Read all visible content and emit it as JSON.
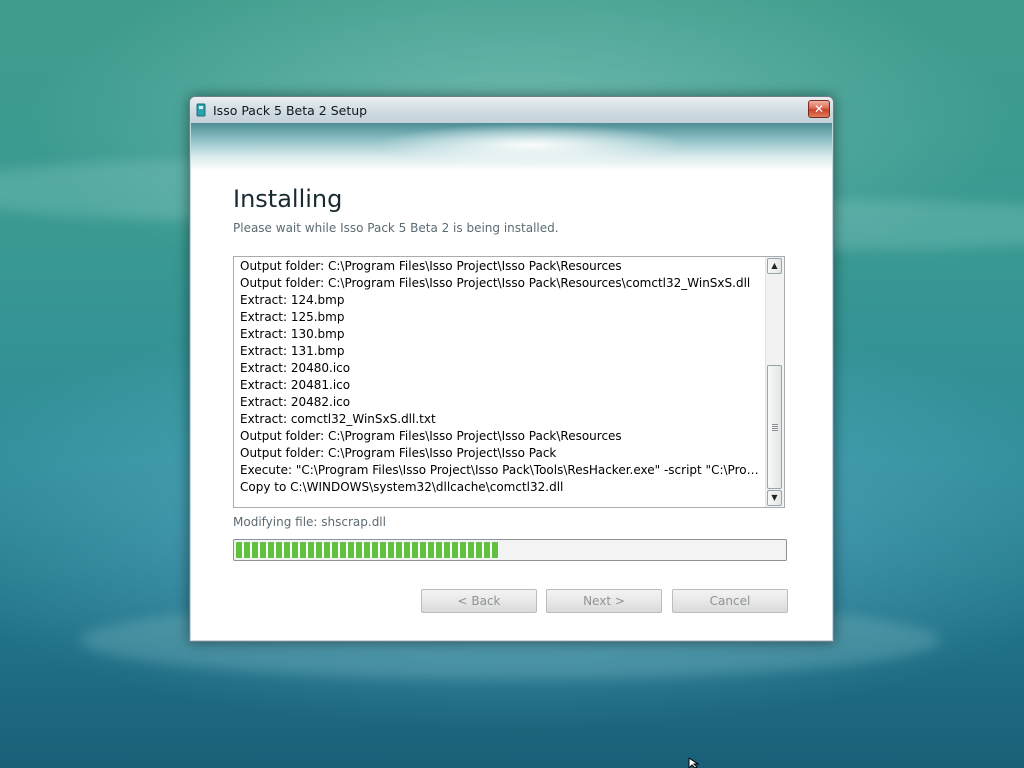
{
  "window": {
    "title": "Isso Pack 5 Beta 2 Setup",
    "close_label": "✕"
  },
  "page": {
    "heading": "Installing",
    "subheading": "Please wait while Isso Pack 5 Beta 2 is being installed."
  },
  "log": {
    "lines": [
      "Output folder: C:\\Program Files\\Isso Project\\Isso Pack\\Resources",
      "Output folder: C:\\Program Files\\Isso Project\\Isso Pack\\Resources\\comctl32_WinSxS.dll",
      "Extract: 124.bmp",
      "Extract: 125.bmp",
      "Extract: 130.bmp",
      "Extract: 131.bmp",
      "Extract: 20480.ico",
      "Extract: 20481.ico",
      "Extract: 20482.ico",
      "Extract: comctl32_WinSxS.dll.txt",
      "Output folder: C:\\Program Files\\Isso Project\\Isso Pack\\Resources",
      "Output folder: C:\\Program Files\\Isso Project\\Isso Pack",
      "Execute: \"C:\\Program Files\\Isso Project\\Isso Pack\\Tools\\ResHacker.exe\" -script \"C:\\Prog...",
      "Copy to C:\\WINDOWS\\system32\\dllcache\\comctl32.dll"
    ],
    "scroll_up_icon": "▲",
    "scroll_down_icon": "▼"
  },
  "status": {
    "text": "Modifying file: shscrap.dll",
    "progress_fraction": 0.48
  },
  "buttons": {
    "back": "< Back",
    "next": "Next >",
    "cancel": "Cancel"
  },
  "colors": {
    "progress": "#5ec23d",
    "close_button": "#d0553a"
  }
}
